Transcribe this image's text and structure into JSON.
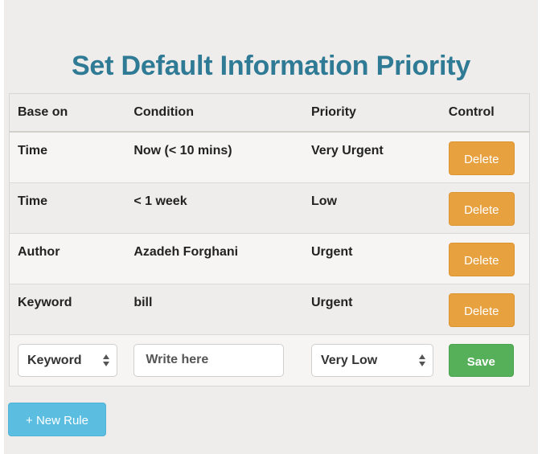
{
  "page": {
    "title": "Set Default Information Priority"
  },
  "table": {
    "headers": {
      "base_on": "Base on",
      "condition": "Condition",
      "priority": "Priority",
      "control": "Control"
    },
    "rows": [
      {
        "base_on": "Time",
        "condition": "Now (< 10 mins)",
        "priority": "Very Urgent",
        "action_label": "Delete"
      },
      {
        "base_on": "Time",
        "condition": "< 1 week",
        "priority": "Low",
        "action_label": "Delete"
      },
      {
        "base_on": "Author",
        "condition": "Azadeh Forghani",
        "priority": "Urgent",
        "action_label": "Delete"
      },
      {
        "base_on": "Keyword",
        "condition": "bill",
        "priority": "Urgent",
        "action_label": "Delete"
      }
    ],
    "new_row": {
      "base_on_selected": "Keyword",
      "condition_value": "",
      "condition_placeholder": "Write here",
      "priority_selected": "Very Low",
      "save_label": "Save"
    }
  },
  "actions": {
    "new_rule_label": "+ New Rule"
  },
  "colors": {
    "title": "#2f7a94",
    "delete_button": "#e8a13f",
    "save_button": "#56b05a",
    "new_rule_button": "#5bbde0",
    "panel_background": "#efedeb"
  },
  "icons": {
    "select_arrow": "up-down-chevron-icon"
  }
}
